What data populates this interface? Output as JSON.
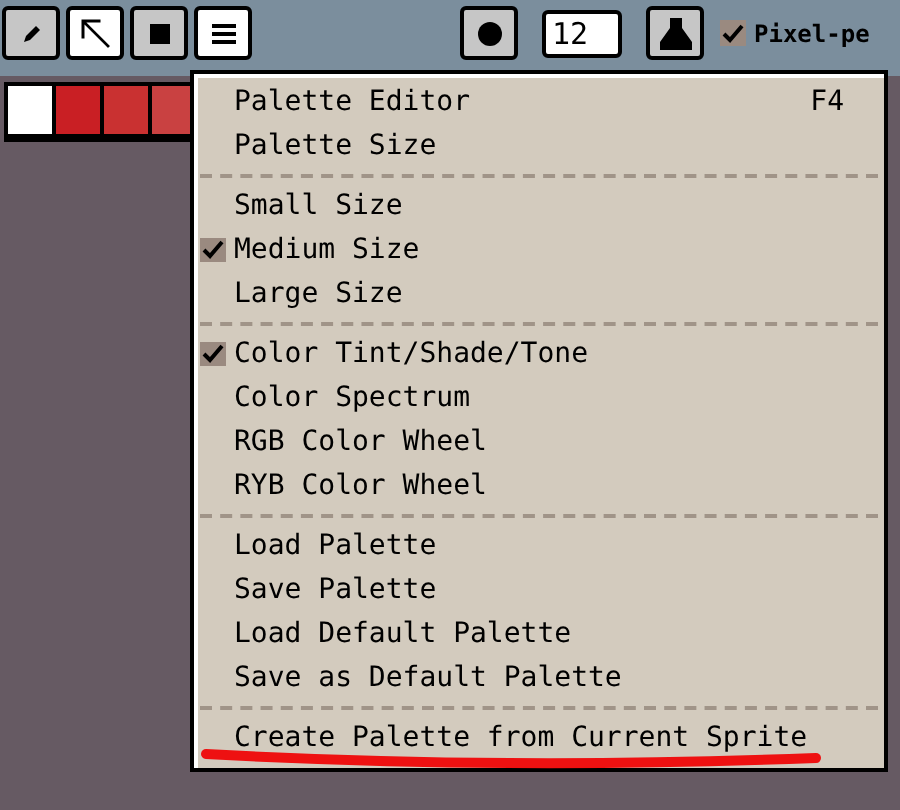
{
  "toolbar": {
    "buttons": [
      {
        "kind": "pencil",
        "selected": false
      },
      {
        "kind": "arrow",
        "selected": true
      },
      {
        "kind": "square",
        "selected": false
      },
      {
        "kind": "menu",
        "selected": true
      }
    ],
    "brush_buttons": [
      {
        "kind": "circle"
      },
      {
        "kind": "size"
      },
      {
        "kind": "ink"
      }
    ],
    "brush_size": {
      "value": "12"
    },
    "pixel_perfect": {
      "label": "Pixel-pe",
      "checked": true
    }
  },
  "palette": {
    "swatches": [
      {
        "color": "#ffffff"
      },
      {
        "color": "#c91f24"
      },
      {
        "color": "#c93131"
      },
      {
        "color": "#c94141"
      }
    ]
  },
  "menu": {
    "sections": [
      [
        {
          "label": "Palette Editor",
          "shortcut": "F4",
          "checked": false
        },
        {
          "label": "Palette Size",
          "checked": false
        }
      ],
      [
        {
          "label": "Small Size",
          "checked": false
        },
        {
          "label": "Medium Size",
          "checked": true
        },
        {
          "label": "Large Size",
          "checked": false
        }
      ],
      [
        {
          "label": "Color Tint/Shade/Tone",
          "checked": true
        },
        {
          "label": "Color Spectrum",
          "checked": false
        },
        {
          "label": "RGB Color Wheel",
          "checked": false
        },
        {
          "label": "RYB Color Wheel",
          "checked": false
        }
      ],
      [
        {
          "label": "Load Palette",
          "checked": false
        },
        {
          "label": "Save Palette",
          "checked": false
        },
        {
          "label": "Load Default Palette",
          "checked": false
        },
        {
          "label": "Save as Default Palette",
          "checked": false
        }
      ],
      [
        {
          "label": "Create Palette from Current Sprite",
          "checked": false
        }
      ]
    ]
  }
}
